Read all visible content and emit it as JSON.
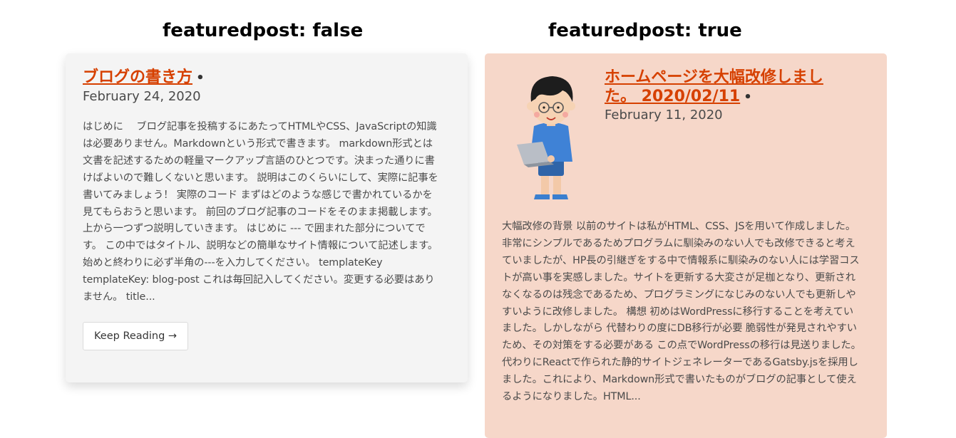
{
  "headings": {
    "left": "featuredpost: false",
    "right": "featuredpost: true"
  },
  "left_card": {
    "title": "ブログの書き方",
    "separator": "•",
    "date": "February 24, 2020",
    "excerpt": "はじめに　 ブログ記事を投稿するにあたってHTMLやCSS、JavaScriptの知識は必要ありません。Markdownという形式で書きます。 markdown形式とは文書を記述するための軽量マークアップ言語のひとつです。決まった通りに書けばよいので難しくないと思います。 説明はこのくらいにして、実際に記事を書いてみましょう！ 実際のコード まずはどのような感じで書かれているかを見てもらおうと思います。 前回のブログ記事のコードをそのまま掲載します。 上から一つずつ説明していきます。 はじめに --- で囲まれた部分についてです。 この中ではタイトル、説明などの簡単なサイト情報について記述します。 始めと終わりに必ず半角の---を入力してください。 templateKey templateKey: blog-post これは毎回記入してください。変更する必要はありません。 title...",
    "button_label": "Keep Reading →"
  },
  "right_card": {
    "title": "ホームページを大幅改修しました。 2020/02/11",
    "separator": "•",
    "date": "February 11, 2020",
    "thumbnail_icon": "boy-with-laptop-illustration",
    "excerpt": "大幅改修の背景 以前のサイトは私がHTML、CSS、JSを用いて作成しました。非常にシンプルであるためプログラムに馴染みのない人でも改修できると考えていましたが、HP長の引継ぎをする中で情報系に馴染みのない人には学習コストが高い事を実感しました。サイトを更新する大変さが足枷となり、更新されなくなるのは残念であるため、プログラミングになじみのない人でも更新しやすいように改修しました。 構想 初めはWordPressに移行することを考えていました。しかしながら 代替わりの度にDB移行が必要 脆弱性が発見されやすいため、その対策をする必要がある この点でWordPressの移行は見送りました。 代わりにReactで作られた静的サイトジェネレーターであるGatsby.jsを採用しました。これにより、Markdown形式で書いたものがブログの記事として使えるようになりました。HTML..."
  },
  "colors": {
    "title_link": "#d64000",
    "left_card_bg": "#f4f4f4",
    "right_card_bg": "#f6d7c9"
  }
}
